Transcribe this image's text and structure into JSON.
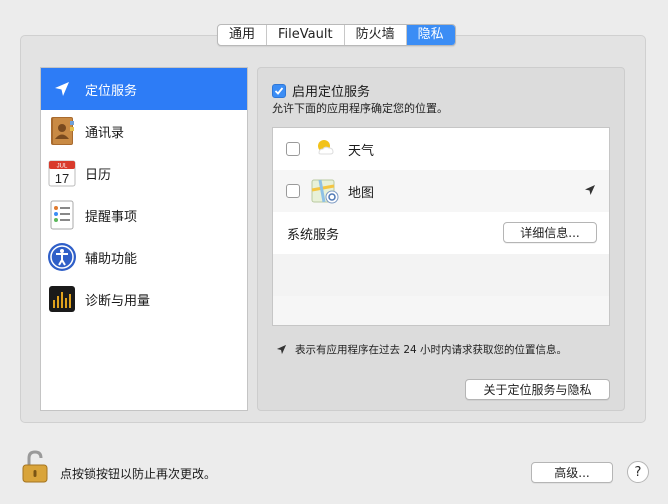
{
  "tabs": [
    {
      "label": "通用",
      "active": false
    },
    {
      "label": "FileVault",
      "active": false
    },
    {
      "label": "防火墙",
      "active": false
    },
    {
      "label": "隐私",
      "active": true
    }
  ],
  "sidebar": {
    "items": [
      {
        "label": "定位服务",
        "icon": "location-arrow-icon",
        "selected": true
      },
      {
        "label": "通讯录",
        "icon": "contacts-book-icon",
        "selected": false
      },
      {
        "label": "日历",
        "icon": "calendar-icon",
        "selected": false
      },
      {
        "label": "提醒事项",
        "icon": "reminders-icon",
        "selected": false
      },
      {
        "label": "辅助功能",
        "icon": "accessibility-icon",
        "selected": false
      },
      {
        "label": "诊断与用量",
        "icon": "diagnostics-icon",
        "selected": false
      }
    ],
    "calendar_icon": {
      "month": "JUL",
      "day": "17"
    }
  },
  "location": {
    "enable_label": "启用定位服务",
    "enabled": true,
    "subtitle": "允许下面的应用程序确定您的位置。",
    "apps": [
      {
        "name": "天气",
        "checked": false,
        "icon": "weather-icon",
        "recent": false
      },
      {
        "name": "地图",
        "checked": false,
        "icon": "maps-icon",
        "recent": true
      }
    ],
    "system_services_label": "系统服务",
    "details_button": "详细信息...",
    "note": "表示有应用程序在过去 24 小时内请求获取您的位置信息。",
    "about_button": "关于定位服务与隐私"
  },
  "footer": {
    "lock_text": "点按锁按钮以防止再次更改。",
    "advanced_button": "高级...",
    "help_label": "?"
  },
  "colors": {
    "accent": "#3b8df5",
    "selected_row": "#2d7cf6",
    "window_bg": "#ececec"
  }
}
